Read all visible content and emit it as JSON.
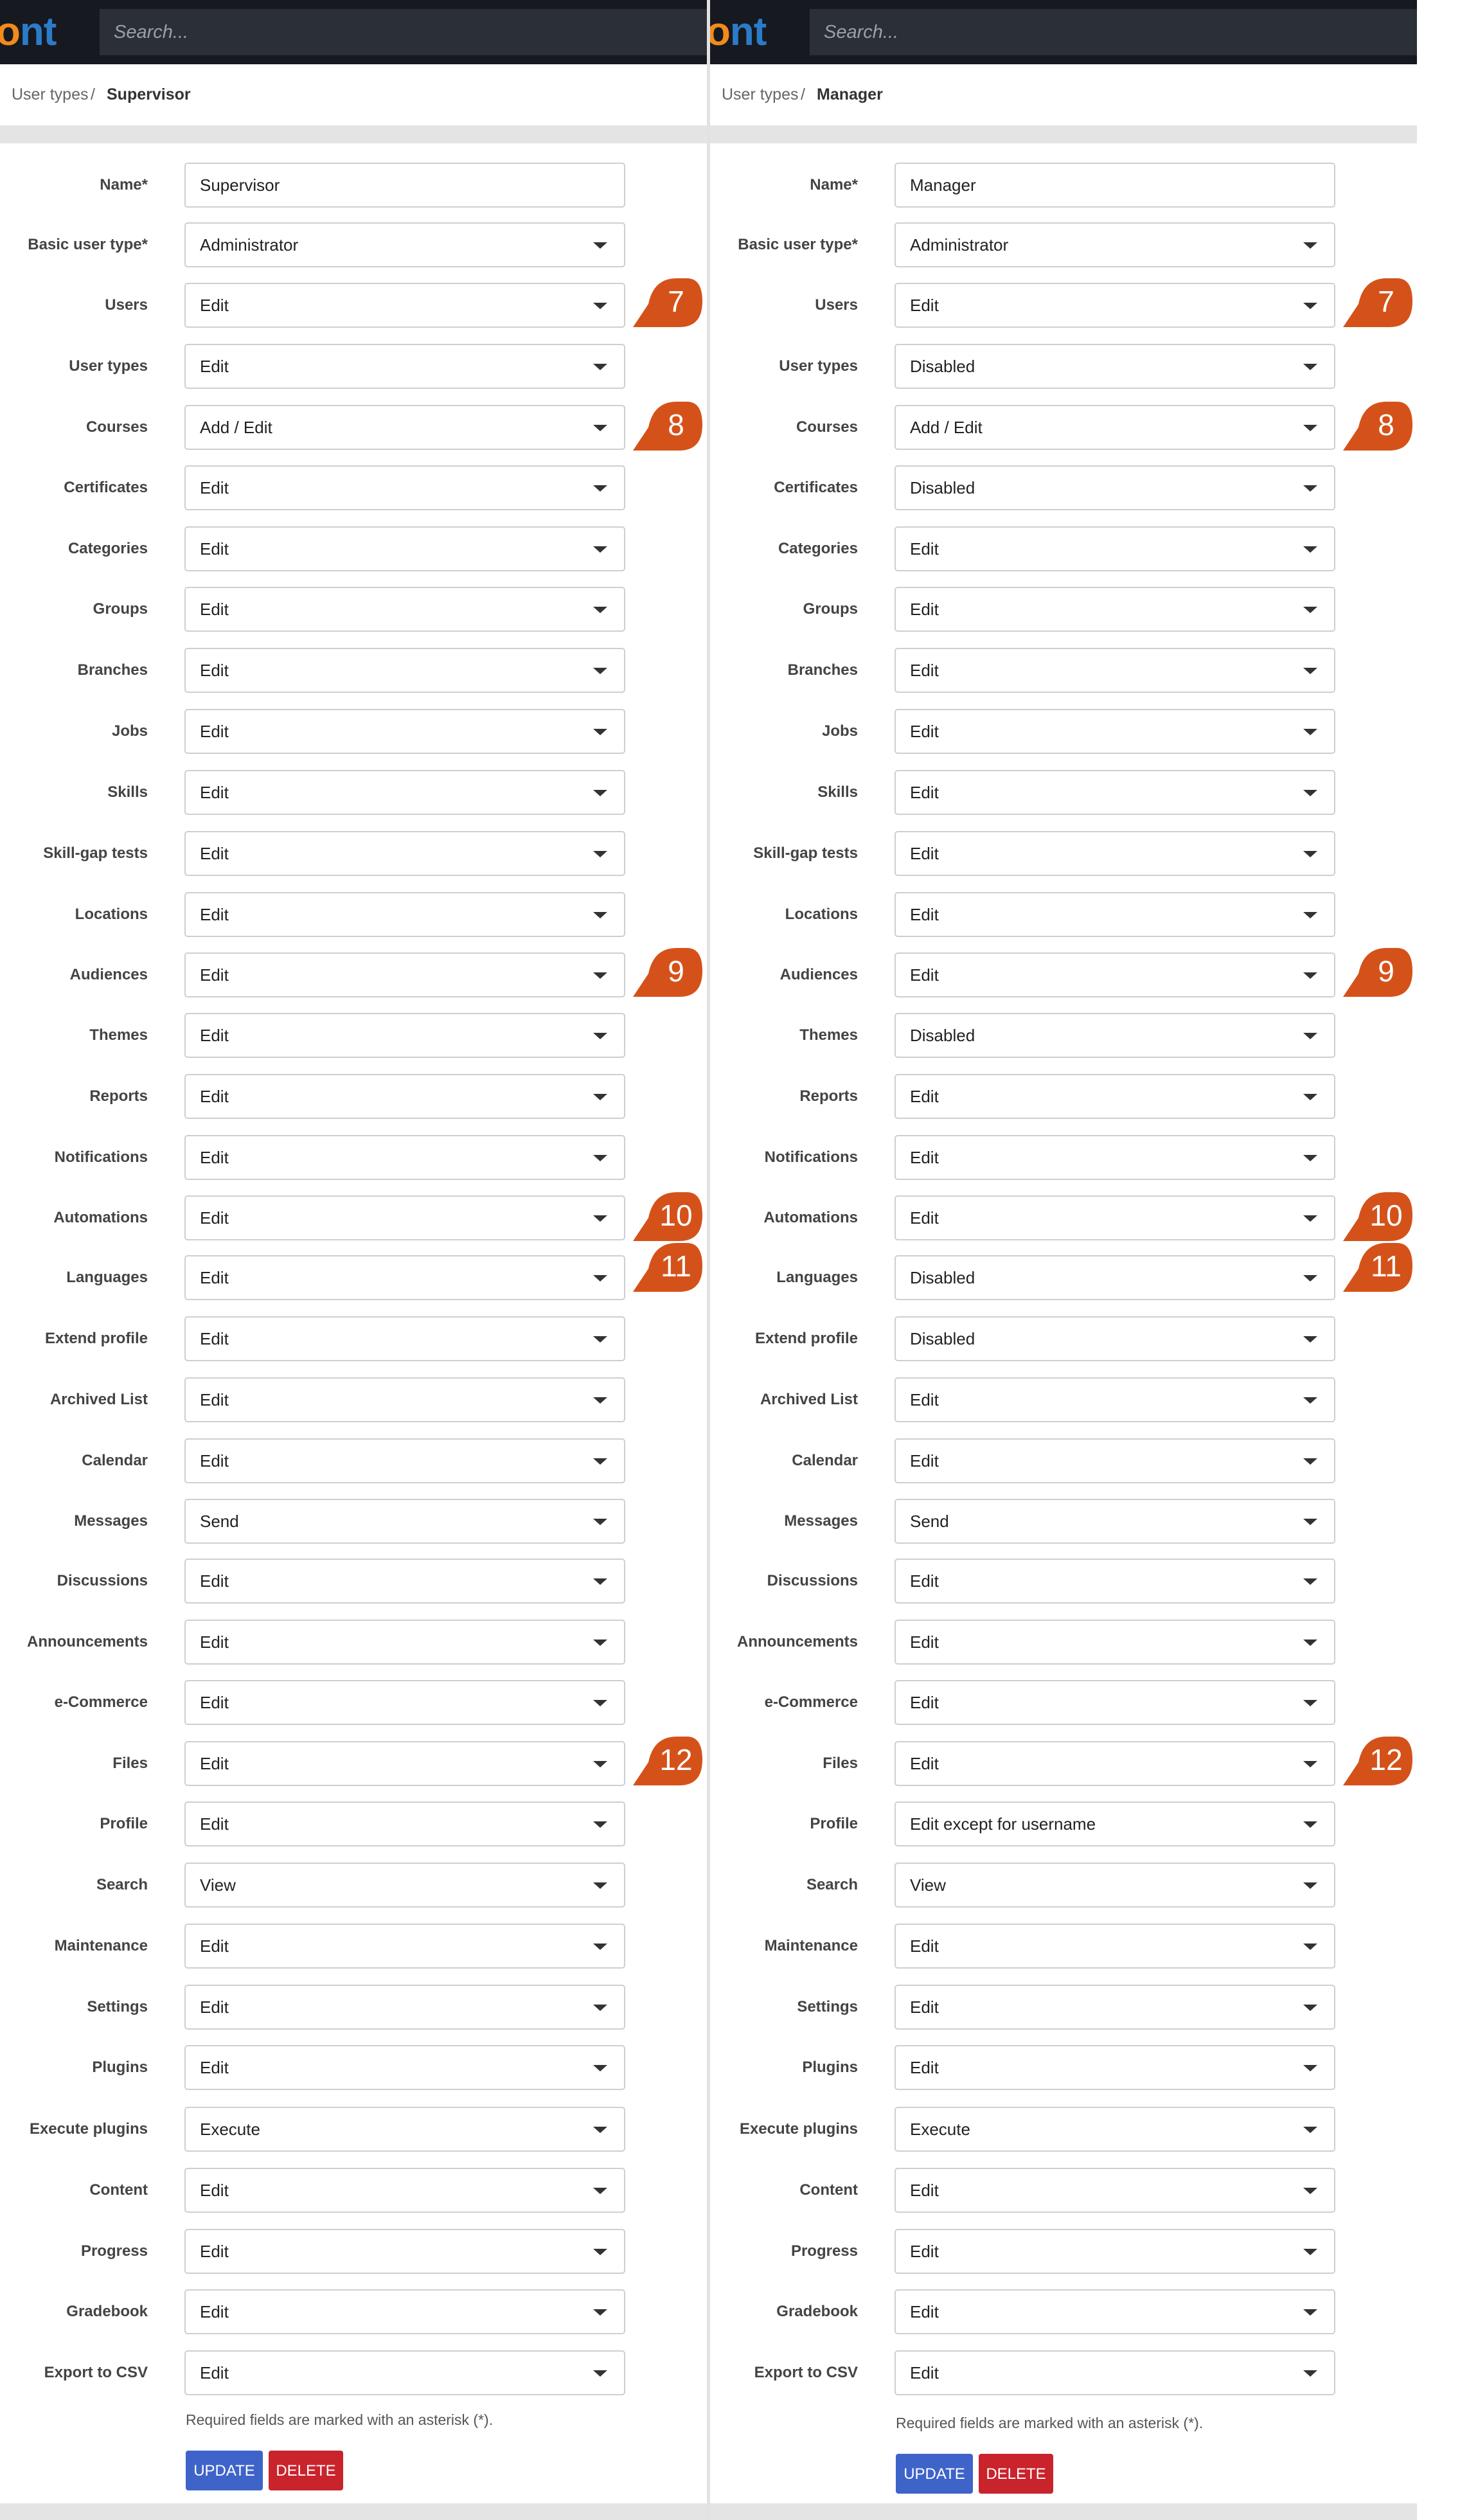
{
  "app": {
    "logo_o": "o",
    "logo_rest": "nt",
    "search_placeholder": "Search..."
  },
  "colors": {
    "badge": "#d4521a",
    "update": "#3e64c9",
    "delete": "#c9232c",
    "topbar": "#16191f"
  },
  "labels": [
    "Name*",
    "Basic user type*",
    "Users",
    "User types",
    "Courses",
    "Certificates",
    "Categories",
    "Groups",
    "Branches",
    "Jobs",
    "Skills",
    "Skill-gap tests",
    "Locations",
    "Audiences",
    "Themes",
    "Reports",
    "Notifications",
    "Automations",
    "Languages",
    "Extend profile",
    "Archived List",
    "Calendar",
    "Messages",
    "Discussions",
    "Announcements",
    "e-Commerce",
    "Files",
    "Profile",
    "Search",
    "Maintenance",
    "Settings",
    "Plugins",
    "Execute plugins",
    "Content",
    "Progress",
    "Gradebook",
    "Export to CSV"
  ],
  "panels": [
    {
      "breadcrumb": {
        "parent": "User types",
        "separator": "/",
        "current": "Supervisor"
      },
      "values": [
        "Supervisor",
        "Administrator",
        "Edit",
        "Edit",
        "Add / Edit",
        "Edit",
        "Edit",
        "Edit",
        "Edit",
        "Edit",
        "Edit",
        "Edit",
        "Edit",
        "Edit",
        "Edit",
        "Edit",
        "Edit",
        "Edit",
        "Edit",
        "Edit",
        "Edit",
        "Edit",
        "Send",
        "Edit",
        "Edit",
        "Edit",
        "Edit",
        "Edit",
        "View",
        "Edit",
        "Edit",
        "Edit",
        "Execute",
        "Edit",
        "Edit",
        "Edit",
        "Edit"
      ],
      "badges": [
        "7",
        "8",
        "9",
        "10",
        "11",
        "12"
      ],
      "note": "Required fields are marked with an asterisk (*).",
      "update_label": "UPDATE",
      "delete_label": "DELETE"
    },
    {
      "breadcrumb": {
        "parent": "User types",
        "separator": "/",
        "current": "Manager"
      },
      "values": [
        "Manager",
        "Administrator",
        "Edit",
        "Disabled",
        "Add / Edit",
        "Disabled",
        "Edit",
        "Edit",
        "Edit",
        "Edit",
        "Edit",
        "Edit",
        "Edit",
        "Edit",
        "Disabled",
        "Edit",
        "Edit",
        "Edit",
        "Disabled",
        "Disabled",
        "Edit",
        "Edit",
        "Send",
        "Edit",
        "Edit",
        "Edit",
        "Edit",
        "Edit except for username",
        "View",
        "Edit",
        "Edit",
        "Edit",
        "Execute",
        "Edit",
        "Edit",
        "Edit",
        "Edit"
      ],
      "badges": [
        "7",
        "8",
        "9",
        "10",
        "11",
        "12"
      ],
      "note": "Required fields are marked with an asterisk (*).",
      "update_label": "UPDATE",
      "delete_label": "DELETE"
    }
  ]
}
